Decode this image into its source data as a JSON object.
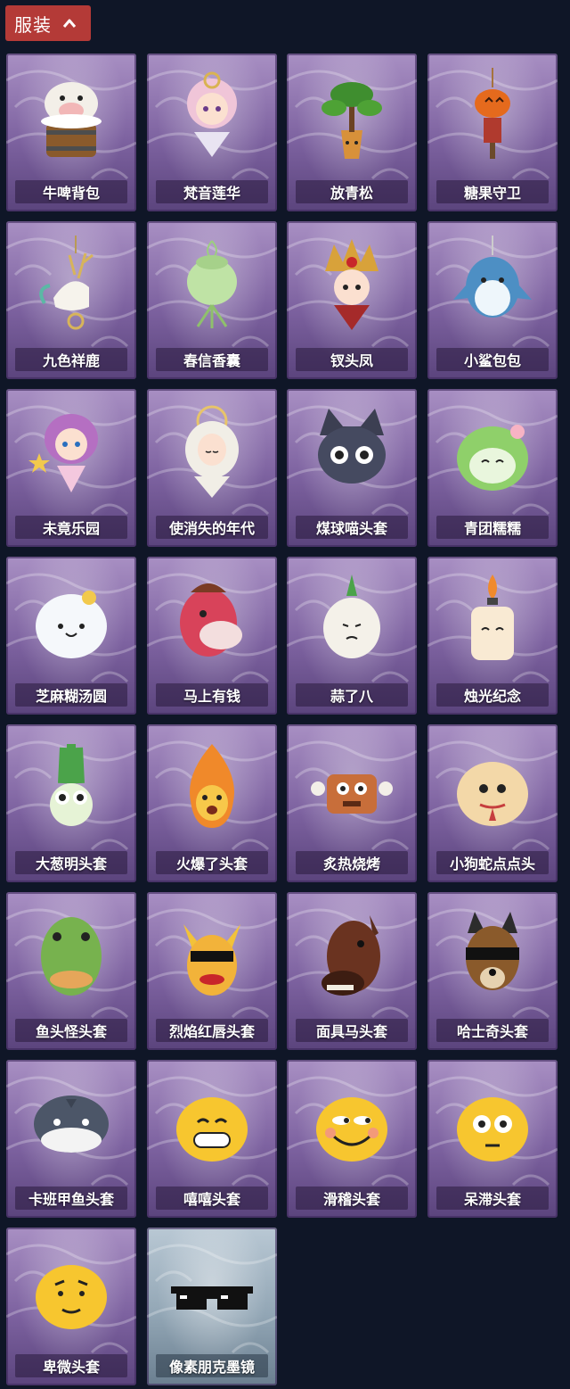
{
  "header": {
    "title": "服装",
    "toggle_icon": "chevron-up-icon",
    "accent": "#b43a37"
  },
  "items": [
    {
      "label": "牛啤背包",
      "icon": "cow-beer-barrel-icon"
    },
    {
      "label": "梵音莲华",
      "icon": "pink-hair-girl-icon"
    },
    {
      "label": "放青松",
      "icon": "pine-bonsai-icon"
    },
    {
      "label": "糖果守卫",
      "icon": "pumpkin-scarecrow-icon"
    },
    {
      "label": "九色祥鹿",
      "icon": "deer-ornament-icon"
    },
    {
      "label": "春信香囊",
      "icon": "green-sachet-icon"
    },
    {
      "label": "钗头凤",
      "icon": "phoenix-crown-girl-icon"
    },
    {
      "label": "小鲨包包",
      "icon": "shark-pendant-icon"
    },
    {
      "label": "未竟乐园",
      "icon": "star-girl-icon"
    },
    {
      "label": "使消失的年代",
      "icon": "veiled-girl-icon"
    },
    {
      "label": "煤球喵头套",
      "icon": "black-cat-head-icon"
    },
    {
      "label": "青团糯糯",
      "icon": "green-dumpling-icon"
    },
    {
      "label": "芝麻糊汤圆",
      "icon": "white-dumpling-icon"
    },
    {
      "label": "马上有钱",
      "icon": "red-horse-head-icon"
    },
    {
      "label": "蒜了八",
      "icon": "garlic-icon"
    },
    {
      "label": "烛光纪念",
      "icon": "candle-icon"
    },
    {
      "label": "大葱明头套",
      "icon": "scallion-head-icon"
    },
    {
      "label": "火爆了头套",
      "icon": "fire-head-icon"
    },
    {
      "label": "炙热烧烤",
      "icon": "meat-bone-icon"
    },
    {
      "label": "小狗蛇点点头",
      "icon": "snake-head-icon"
    },
    {
      "label": "鱼头怪头套",
      "icon": "fish-head-icon"
    },
    {
      "label": "烈焰红唇头套",
      "icon": "yellow-sunglasses-head-icon"
    },
    {
      "label": "面具马头套",
      "icon": "horse-mask-icon"
    },
    {
      "label": "哈士奇头套",
      "icon": "husky-sunglasses-icon"
    },
    {
      "label": "卡班甲鱼头套",
      "icon": "gray-fish-head-icon"
    },
    {
      "label": "嘻嘻头套",
      "icon": "grin-emoji-icon"
    },
    {
      "label": "滑稽头套",
      "icon": "smirk-emoji-icon"
    },
    {
      "label": "呆滞头套",
      "icon": "stare-emoji-icon"
    },
    {
      "label": "卑微头套",
      "icon": "humble-emoji-icon"
    },
    {
      "label": "像素朋克墨镜",
      "icon": "pixel-sunglasses-icon",
      "rarity": "gray"
    }
  ]
}
